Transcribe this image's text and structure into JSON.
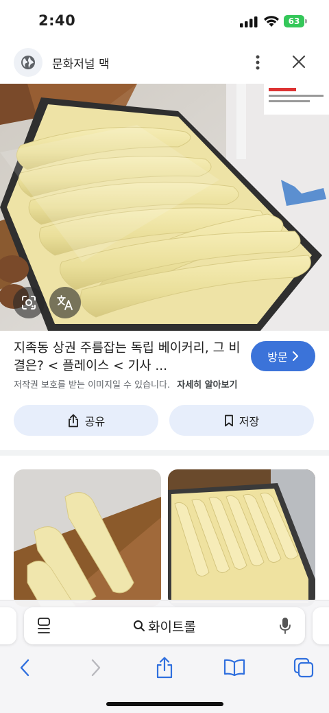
{
  "status_bar": {
    "time": "2:40",
    "battery": "63"
  },
  "header": {
    "site_name": "문화저널 맥"
  },
  "result": {
    "title": "지족동 상권 주름잡는 독립 베이커리, 그 비결은? < 플레이스 < 기사 ...",
    "visit_label": "방문",
    "copyright_text": "저작권 보호를 받는 이미지일 수 있습니다.",
    "learn_more": "자세히 알아보기",
    "share_label": "공유",
    "save_label": "저장"
  },
  "address_bar": {
    "query": "화이트롤"
  },
  "colors": {
    "accent": "#3b73d9",
    "pill_bg": "#e7eefb",
    "battery": "#34c759"
  },
  "icons": [
    "globe-icon",
    "more-vertical-icon",
    "close-icon",
    "lens-icon",
    "translate-icon",
    "chevron-right-icon",
    "share-icon",
    "bookmark-icon",
    "reader-icon",
    "search-icon",
    "mic-icon",
    "back-icon",
    "forward-icon",
    "share-nav-icon",
    "book-icon",
    "tabs-icon"
  ]
}
